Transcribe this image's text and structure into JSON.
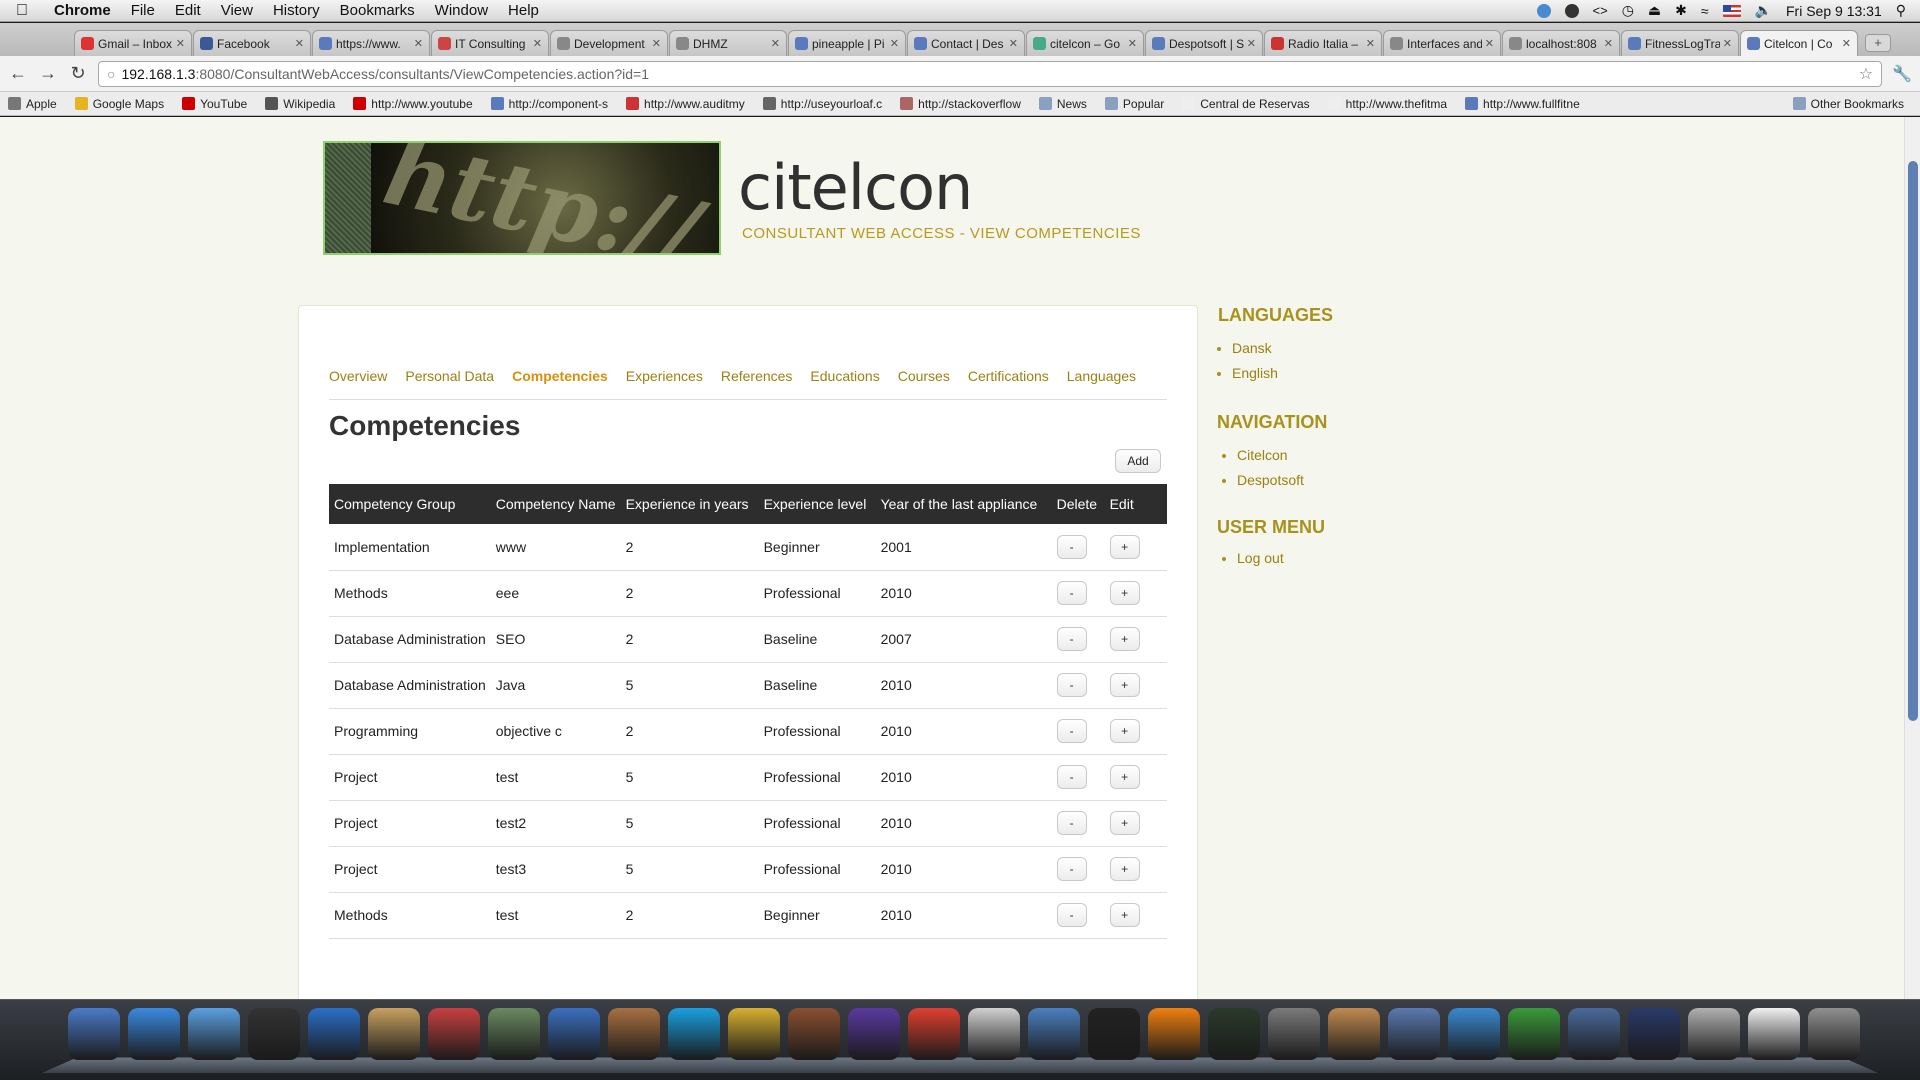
{
  "menubar": {
    "items": [
      "Chrome",
      "File",
      "Edit",
      "View",
      "History",
      "Bookmarks",
      "Window",
      "Help"
    ],
    "clock": "Fri Sep 9  13:31"
  },
  "tabs": [
    {
      "title": "Gmail – Inbox",
      "color": "#d33"
    },
    {
      "title": "Facebook",
      "color": "#3b5998"
    },
    {
      "title": "https://www.",
      "color": "#5a7abc"
    },
    {
      "title": "IT Consulting",
      "color": "#c44"
    },
    {
      "title": "Development",
      "color": "#888"
    },
    {
      "title": "DHMZ",
      "color": "#888"
    },
    {
      "title": "pineapple | Pi",
      "color": "#5a7abc"
    },
    {
      "title": "Contact | Des",
      "color": "#5a7abc"
    },
    {
      "title": "citelcon – Go",
      "color": "#4a8"
    },
    {
      "title": "Despotsoft | S",
      "color": "#5a7abc"
    },
    {
      "title": "Radio Italia –",
      "color": "#c33"
    },
    {
      "title": "Interfaces and",
      "color": "#888"
    },
    {
      "title": "localhost:808",
      "color": "#888"
    },
    {
      "title": "FitnessLogTra",
      "color": "#5a7abc"
    },
    {
      "title": "Citelcon | Co",
      "color": "#5a7abc"
    }
  ],
  "address": {
    "host": "192.168.1.3",
    "rest": ":8080/ConsultantWebAccess/consultants/ViewCompetencies.action?id=1"
  },
  "bookmarks": [
    {
      "label": "Apple",
      "color": "#777"
    },
    {
      "label": "Google Maps",
      "color": "#e6b422"
    },
    {
      "label": "YouTube",
      "color": "#c00"
    },
    {
      "label": "Wikipedia",
      "color": "#555"
    },
    {
      "label": "http://www.youtube",
      "color": "#c00"
    },
    {
      "label": "http://component-s",
      "color": "#5a7abc"
    },
    {
      "label": "http://www.auditmy",
      "color": "#c33"
    },
    {
      "label": "http://useyourloaf.c",
      "color": "#666"
    },
    {
      "label": "http://stackoverflow",
      "color": "#a66"
    },
    {
      "label": "News",
      "color": "#8aa0c0"
    },
    {
      "label": "Popular",
      "color": "#8aa0c0"
    },
    {
      "label": "Central de Reservas",
      "color": "#eee"
    },
    {
      "label": "http://www.thefitma",
      "color": "#eee"
    },
    {
      "label": "http://www.fullfitne",
      "color": "#5a7abc"
    }
  ],
  "bookmarks_other": "Other Bookmarks",
  "site": {
    "brand": "citelcon",
    "subtitle": "CONSULTANT WEB ACCESS - VIEW COMPETENCIES",
    "nav_tabs": [
      "Overview",
      "Personal Data",
      "Competencies",
      "Experiences",
      "References",
      "Educations",
      "Courses",
      "Certifications",
      "Languages"
    ],
    "page_title": "Competencies",
    "add_label": "Add",
    "table": {
      "headers": [
        "Competency Group",
        "Competency Name",
        "Experience in years",
        "Experience level",
        "Year of the last appliance",
        "Delete",
        "Edit"
      ],
      "delete_label": "-",
      "edit_label": "+",
      "rows": [
        [
          "Implementation",
          "www",
          "2",
          "Beginner",
          "2001"
        ],
        [
          "Methods",
          "eee",
          "2",
          "Professional",
          "2010"
        ],
        [
          "Database Administration",
          "SEO",
          "2",
          "Baseline",
          "2007"
        ],
        [
          "Database Administration",
          "Java",
          "5",
          "Baseline",
          "2010"
        ],
        [
          "Programming",
          "objective c",
          "2",
          "Professional",
          "2010"
        ],
        [
          "Project",
          "test",
          "5",
          "Professional",
          "2010"
        ],
        [
          "Project",
          "test2",
          "5",
          "Professional",
          "2010"
        ],
        [
          "Project",
          "test3",
          "5",
          "Professional",
          "2010"
        ],
        [
          "Methods",
          "test",
          "2",
          "Beginner",
          "2010"
        ]
      ]
    },
    "sidebar": {
      "languages_title": "LANGUAGES",
      "languages": [
        "Dansk",
        "English"
      ],
      "navigation_title": "NAVIGATION",
      "navigation": [
        "Citelcon",
        "Despotsoft"
      ],
      "user_menu_title": "USER MENU",
      "user_menu": [
        "Log out"
      ]
    }
  },
  "colors": {
    "accent_gold": "#9a8212",
    "active_tab": "#d98f0c",
    "table_header_bg": "#2d2d2d",
    "page_bg": "#f5f6ee"
  }
}
